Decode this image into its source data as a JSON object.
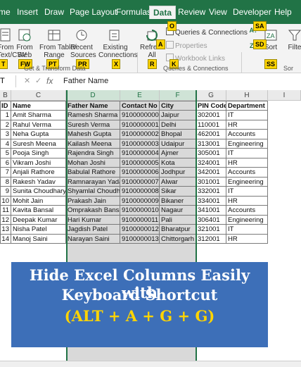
{
  "tabs": [
    "me",
    "Insert",
    "Draw",
    "Page Layout",
    "Formulas",
    "Data",
    "Review",
    "View",
    "Developer",
    "Help"
  ],
  "active_tab": "Data",
  "ribbon": {
    "buttons": {
      "from_text_csv": "From\nText/CSV",
      "from_web": "From\nWeb",
      "from_table": "From Table/\nRange",
      "recent_sources": "Recent\nSources",
      "existing_connections": "Existing\nConnections",
      "refresh_all": "Refresh\nAll",
      "queries_connections": "Queries & Connections",
      "properties": "Properties",
      "workbook_links": "Workbook Links",
      "sort": "Sort",
      "filter": "Filte"
    },
    "groups": {
      "get_transform": "Get & Transform Data",
      "queries": "Queries & Connections",
      "sort": "Sor"
    },
    "keytips": {
      "t": "T",
      "fw": "FW",
      "pt": "PT",
      "pr": "PR",
      "x": "X",
      "r": "R",
      "a": "A",
      "k": "K",
      "o": "O",
      "sa": "SA",
      "sd": "SD",
      "ss": "SS",
      "data_tab": "A"
    }
  },
  "formula_bar": {
    "name_box": "T",
    "fx": "fx",
    "content": "Father Name"
  },
  "grid": {
    "columns": [
      "B",
      "C",
      "D",
      "E",
      "F",
      "G",
      "H",
      "I"
    ],
    "headers": [
      "ID",
      "Name",
      "Father Name",
      "Contact No",
      "City",
      "PIN Code",
      "Department"
    ],
    "rows": [
      [
        "1",
        "Amit Sharma",
        "Ramesh Sharma",
        "9100000000",
        "Jaipur",
        "302001",
        "IT"
      ],
      [
        "2",
        "Rahul Verma",
        "Suresh Verma",
        "9100000001",
        "Delhi",
        "110001",
        "HR"
      ],
      [
        "3",
        "Neha Gupta",
        "Mahesh Gupta",
        "9100000002",
        "Bhopal",
        "462001",
        "Accounts"
      ],
      [
        "4",
        "Suresh Meena",
        "Kailash Meena",
        "9100000003",
        "Udaipur",
        "313001",
        "Engineering"
      ],
      [
        "5",
        "Pooja Singh",
        "Rajendra Singh",
        "9100000004",
        "Ajmer",
        "305001",
        "IT"
      ],
      [
        "6",
        "Vikram Joshi",
        "Mohan Joshi",
        "9100000005",
        "Kota",
        "324001",
        "HR"
      ],
      [
        "7",
        "Anjali Rathore",
        "Babulal Rathore",
        "9100000006",
        "Jodhpur",
        "342001",
        "Accounts"
      ],
      [
        "8",
        "Rakesh Yadav",
        "Ramnarayan Yadav",
        "9100000007",
        "Alwar",
        "301001",
        "Engineering"
      ],
      [
        "9",
        "Sunita Choudhary",
        "Shyamlal Choudhary",
        "9100000008",
        "Sikar",
        "332001",
        "IT"
      ],
      [
        "10",
        "Mohit Jain",
        "Prakash Jain",
        "9100000009",
        "Bikaner",
        "334001",
        "HR"
      ],
      [
        "11",
        "Kavita Bansal",
        "Omprakash Bansal",
        "9100000010",
        "Nagaur",
        "341001",
        "Accounts"
      ],
      [
        "12",
        "Deepak Kumar",
        "Hari Kumar",
        "9100000011",
        "Pali",
        "306401",
        "Engineering"
      ],
      [
        "13",
        "Nisha Patel",
        "Jagdish Patel",
        "9100000012",
        "Bharatpur",
        "321001",
        "IT"
      ],
      [
        "14",
        "Manoj Saini",
        "Narayan Saini",
        "9100000013",
        "Chittorgarh",
        "312001",
        "HR"
      ]
    ]
  },
  "banner": {
    "line1": "Hide Excel Columns Easily with",
    "line2": "Keyboard Shortcut",
    "line3": "(ALT + A + G + G)"
  },
  "colors": {
    "excel_green": "#217346",
    "banner_blue": "#3d6fb8",
    "keytip_yellow": "#ffd400",
    "selection_shade": "#d9d9d9"
  }
}
